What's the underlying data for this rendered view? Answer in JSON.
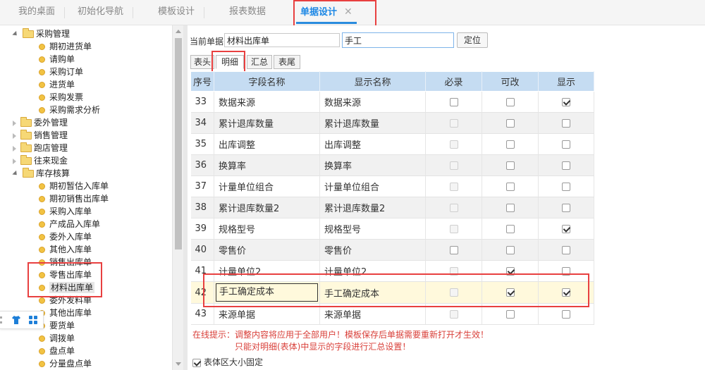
{
  "top_tabs": [
    {
      "label": "我的桌面"
    },
    {
      "label": "初始化导航"
    },
    {
      "label": "模板设计"
    },
    {
      "label": "报表数据"
    },
    {
      "label": "单据设计",
      "close": "✕"
    }
  ],
  "tree": {
    "items": [
      {
        "label": "采购管理",
        "kind": "folder",
        "state": "open"
      },
      {
        "label": "期初进货单",
        "kind": "leaf"
      },
      {
        "label": "请购单",
        "kind": "leaf"
      },
      {
        "label": "采购订单",
        "kind": "leaf"
      },
      {
        "label": "进货单",
        "kind": "leaf"
      },
      {
        "label": "采购发票",
        "kind": "leaf"
      },
      {
        "label": "采购需求分析",
        "kind": "leaf"
      },
      {
        "label": "委外管理",
        "kind": "folder",
        "state": "closed"
      },
      {
        "label": "销售管理",
        "kind": "folder",
        "state": "closed"
      },
      {
        "label": "跑店管理",
        "kind": "folder",
        "state": "closed"
      },
      {
        "label": "往来现金",
        "kind": "folder",
        "state": "closed"
      },
      {
        "label": "库存核算",
        "kind": "folder",
        "state": "open"
      },
      {
        "label": "期初暂估入库单",
        "kind": "leaf"
      },
      {
        "label": "期初销售出库单",
        "kind": "leaf"
      },
      {
        "label": "采购入库单",
        "kind": "leaf"
      },
      {
        "label": "产成品入库单",
        "kind": "leaf"
      },
      {
        "label": "委外入库单",
        "kind": "leaf"
      },
      {
        "label": "其他入库单",
        "kind": "leaf"
      },
      {
        "label": "销售出库单",
        "kind": "leaf"
      },
      {
        "label": "零售出库单",
        "kind": "leaf"
      },
      {
        "label": "材料出库单",
        "kind": "leaf",
        "selected": true
      },
      {
        "label": "委外发料单",
        "kind": "leaf"
      },
      {
        "label": "其他出库单",
        "kind": "leaf"
      },
      {
        "label": "要货单",
        "kind": "leaf"
      },
      {
        "label": "调拨单",
        "kind": "leaf"
      },
      {
        "label": "盘点单",
        "kind": "leaf"
      },
      {
        "label": "分量盘点单",
        "kind": "leaf"
      }
    ]
  },
  "form": {
    "current_label": "当前单据",
    "current_value": "材料出库单",
    "search_value": "手工",
    "locate_label": "定位"
  },
  "sub_tabs": [
    {
      "label": "表头"
    },
    {
      "label": "明细",
      "active": true
    },
    {
      "label": "汇总"
    },
    {
      "label": "表尾"
    }
  ],
  "grid": {
    "headers": [
      "序号",
      "字段名称",
      "显示名称",
      "必录",
      "可改",
      "显示"
    ],
    "rows": [
      {
        "no": "33",
        "field": "数据来源",
        "display": "数据来源",
        "required": false,
        "required_enabled": true,
        "editable": false,
        "editable_enabled": true,
        "visible": true
      },
      {
        "no": "34",
        "field": "累计退库数量",
        "display": "累计退库数量",
        "required": false,
        "required_enabled": false,
        "editable": false,
        "editable_enabled": true,
        "visible": false
      },
      {
        "no": "35",
        "field": "出库调整",
        "display": "出库调整",
        "required": false,
        "required_enabled": false,
        "editable": false,
        "editable_enabled": true,
        "visible": false
      },
      {
        "no": "36",
        "field": "换算率",
        "display": "换算率",
        "required": false,
        "required_enabled": false,
        "editable": false,
        "editable_enabled": true,
        "visible": false
      },
      {
        "no": "37",
        "field": "计量单位组合",
        "display": "计量单位组合",
        "required": false,
        "required_enabled": false,
        "editable": false,
        "editable_enabled": true,
        "visible": false
      },
      {
        "no": "38",
        "field": "累计退库数量2",
        "display": "累计退库数量2",
        "required": false,
        "required_enabled": false,
        "editable": false,
        "editable_enabled": true,
        "visible": false
      },
      {
        "no": "39",
        "field": "规格型号",
        "display": "规格型号",
        "required": false,
        "required_enabled": false,
        "editable": false,
        "editable_enabled": true,
        "visible": true
      },
      {
        "no": "40",
        "field": "零售价",
        "display": "零售价",
        "required": false,
        "required_enabled": true,
        "editable": false,
        "editable_enabled": true,
        "visible": false
      },
      {
        "no": "41",
        "field": "计量单位2",
        "display": "计量单位2",
        "required": false,
        "required_enabled": false,
        "editable": true,
        "editable_enabled": true,
        "visible": false
      },
      {
        "no": "42",
        "field": "手工确定成本",
        "display": "手工确定成本",
        "required": false,
        "required_enabled": false,
        "editable": true,
        "editable_enabled": true,
        "visible": true,
        "selected": true
      },
      {
        "no": "43",
        "field": "来源单据",
        "display": "来源单据",
        "required": false,
        "required_enabled": false,
        "editable": false,
        "editable_enabled": true,
        "visible": false
      }
    ]
  },
  "hint": {
    "line1": "在线提示：调整内容将应用于全部用户！模板保存后单据需要重新打开才生效！",
    "line2": "只能对明细(表体)中显示的字段进行汇总设置！"
  },
  "fixed_size_label": "表体区大小固定",
  "colors": {
    "accent": "#1b87e5",
    "highlight": "#e84040",
    "header_bg": "#c5dcf2",
    "hint": "#d9403a"
  }
}
